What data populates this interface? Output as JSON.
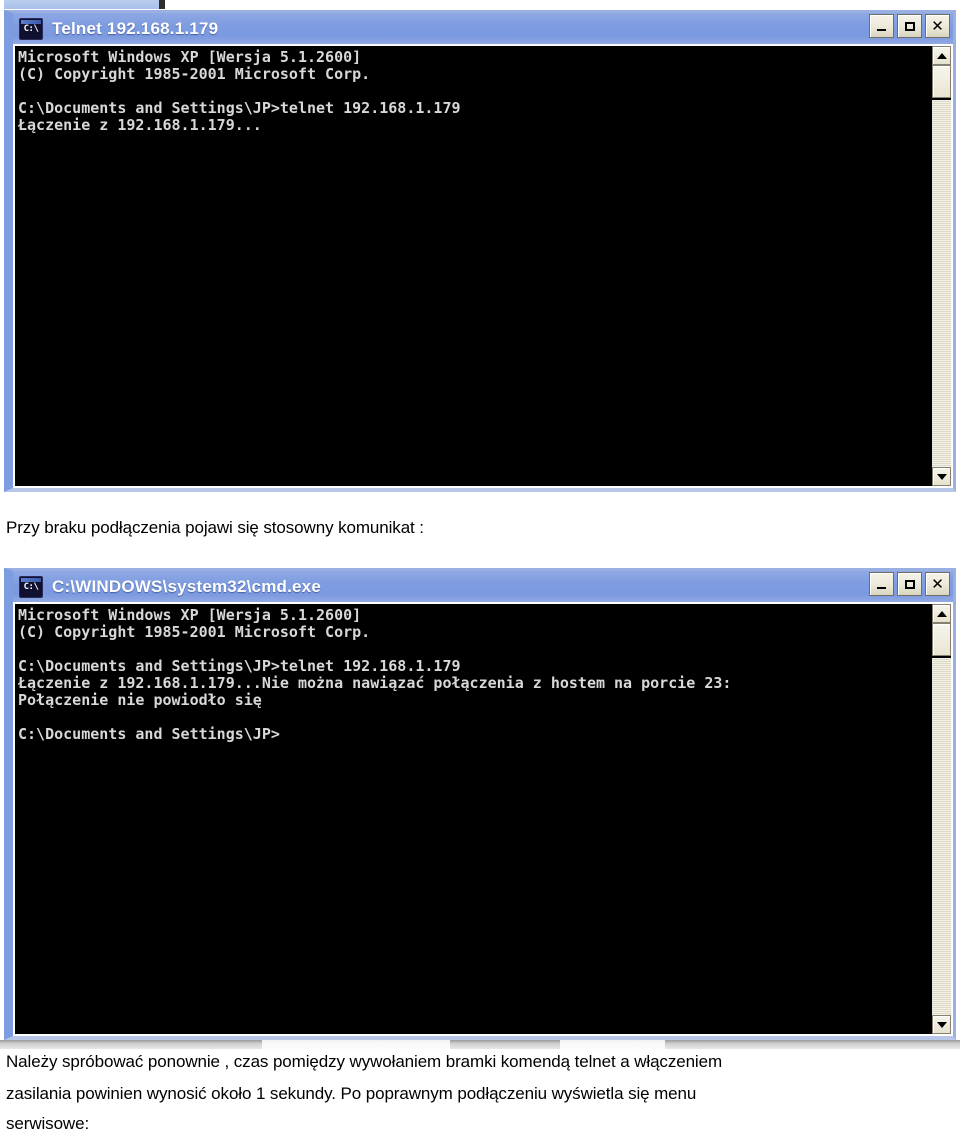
{
  "document": {
    "language": "pl",
    "page_background": "#ffffff"
  },
  "top_artifact": {
    "name": "clipped-window-edge",
    "visible": true
  },
  "window_telnet": {
    "title": "Telnet 192.168.1.179",
    "icon": "console-icon",
    "titlebar_color": "#7e9ce0",
    "background": "#000000",
    "text_color": "#d8d8d8",
    "controls": {
      "minimize": "–",
      "maximize": "□",
      "close": "✕"
    },
    "scrollbar": {
      "up_arrow": "scroll-up-arrow",
      "down_arrow": "scroll-down-arrow",
      "thumb_position_percent": 2
    },
    "lines": [
      "Microsoft Windows XP [Wersja 5.1.2600]",
      "(C) Copyright 1985-2001 Microsoft Corp.",
      "",
      "C:\\Documents and Settings\\JP>telnet 192.168.1.179",
      "Łączenie z 192.168.1.179..."
    ]
  },
  "caption_middle": "Przy braku podłączenia pojawi się stosowny komunikat :",
  "window_cmd": {
    "title": "C:\\WINDOWS\\system32\\cmd.exe",
    "icon": "console-icon",
    "titlebar_color": "#7e9ce0",
    "background": "#000000",
    "text_color": "#d8d8d8",
    "controls": {
      "minimize": "–",
      "maximize": "□",
      "close": "✕"
    },
    "scrollbar": {
      "up_arrow": "scroll-up-arrow",
      "down_arrow": "scroll-down-arrow",
      "thumb_position_percent": 2
    },
    "lines": [
      "Microsoft Windows XP [Wersja 5.1.2600]",
      "(C) Copyright 1985-2001 Microsoft Corp.",
      "",
      "C:\\Documents and Settings\\JP>telnet 192.168.1.179",
      "Łączenie z 192.168.1.179...Nie można nawiązać połączenia z hostem na porcie 23:",
      "Połączenie nie powiodło się",
      "",
      "C:\\Documents and Settings\\JP>"
    ]
  },
  "footer_paragraph": {
    "line1": "Należy spróbować ponownie , czas pomiędzy wywołaniem bramki komendą telnet a włączeniem",
    "line2": "zasilania powinien wynosić około 1 sekundy.  Po poprawnym podłączeniu wyświetla się menu",
    "line3": "serwisowe:"
  }
}
